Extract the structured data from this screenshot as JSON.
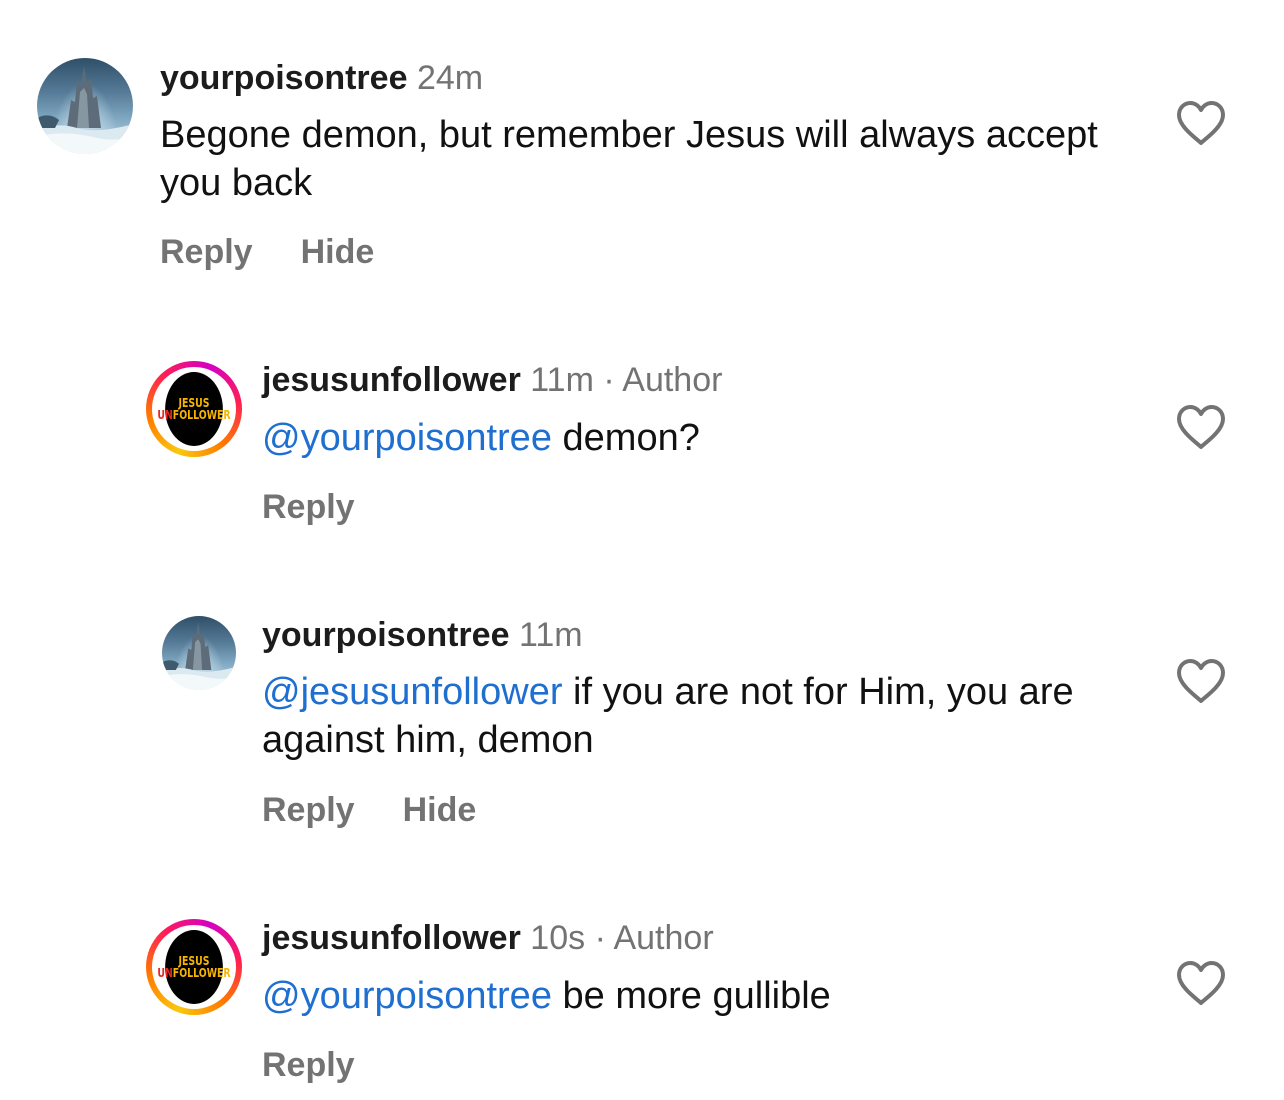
{
  "comments": [
    {
      "username": "yourpoisontree",
      "time": "24m",
      "text_prefix": "",
      "mention": "",
      "text": "Begone demon, but remember Jesus will always accept you back",
      "actions": {
        "reply": "Reply",
        "hide": "Hide"
      }
    },
    {
      "username": "jesusunfollower",
      "time": "11m",
      "separator": "·",
      "badge": "Author",
      "mention": "@yourpoisontree",
      "text": " demon?",
      "actions": {
        "reply": "Reply"
      }
    },
    {
      "username": "yourpoisontree",
      "time": "11m",
      "mention": "@jesusunfollower",
      "text": " if you are not for Him, you are against him, demon",
      "actions": {
        "reply": "Reply",
        "hide": "Hide"
      }
    },
    {
      "username": "jesusunfollower",
      "time": "10s",
      "separator": "·",
      "badge": "Author",
      "mention": "@yourpoisontree",
      "text": " be more gullible",
      "actions": {
        "reply": "Reply"
      }
    }
  ],
  "logo_text": {
    "line1": "JESUS",
    "line2_red": "UN",
    "line2_yellow": "FOLLOWER"
  },
  "colors": {
    "mention": "#1f6fd0",
    "secondary_text": "#737373",
    "primary_text": "#111111",
    "heart_outline": "#737373"
  },
  "icons": {
    "like": "heart-outline-icon",
    "avatar_photo": "castle-island-photo",
    "avatar_logo": "jesus-unfollower-logo"
  }
}
